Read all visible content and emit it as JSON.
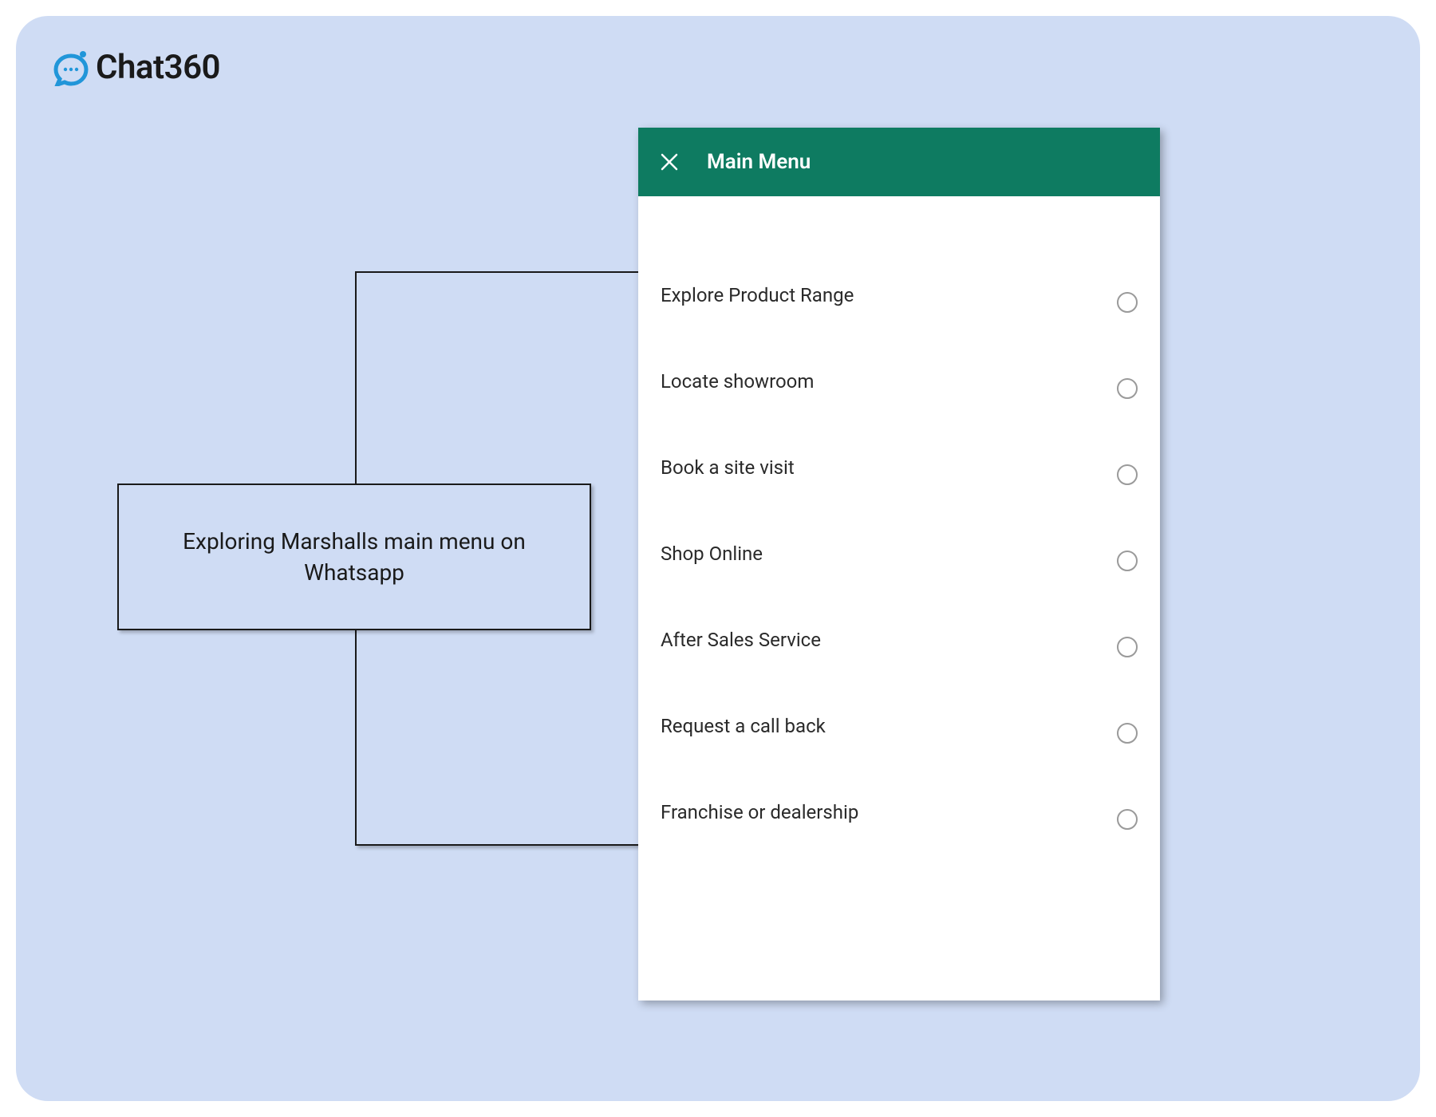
{
  "logo": {
    "text": "Chat360",
    "accent_color": "#2196d9"
  },
  "caption": "Exploring Marshalls main menu on Whatsapp",
  "panel": {
    "title": "Main Menu",
    "header_color": "#0e7b61",
    "items": [
      {
        "label": "Explore Product Range"
      },
      {
        "label": "Locate showroom"
      },
      {
        "label": "Book a site visit"
      },
      {
        "label": "Shop Online"
      },
      {
        "label": "After Sales Service"
      },
      {
        "label": "Request a call back"
      },
      {
        "label": "Franchise or dealership"
      }
    ]
  }
}
